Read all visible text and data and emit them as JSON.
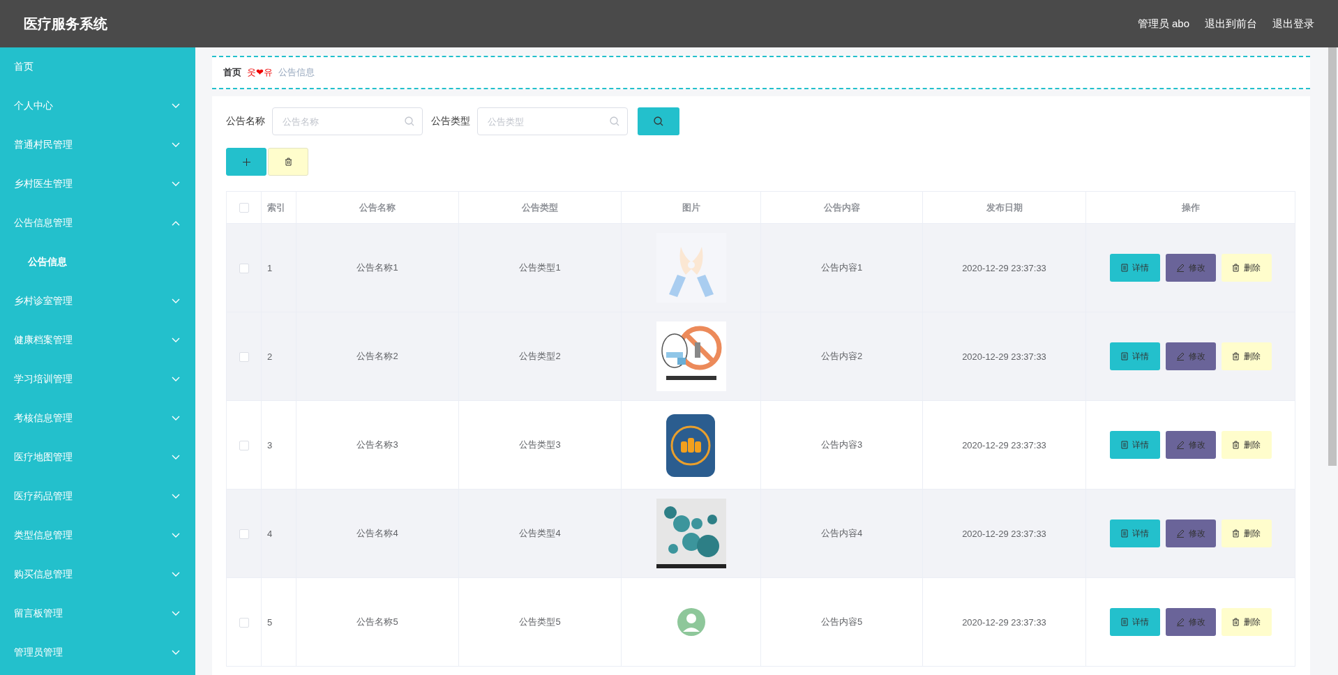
{
  "header": {
    "title": "医疗服务系统",
    "links": [
      "管理员 abo",
      "退出到前台",
      "退出登录"
    ]
  },
  "sidebar": {
    "items": [
      {
        "label": "首页",
        "kind": "link"
      },
      {
        "label": "个人中心",
        "kind": "menu",
        "expanded": false
      },
      {
        "label": "普通村民管理",
        "kind": "menu",
        "expanded": false
      },
      {
        "label": "乡村医生管理",
        "kind": "menu",
        "expanded": false
      },
      {
        "label": "公告信息管理",
        "kind": "menu",
        "expanded": true,
        "children": [
          {
            "label": "公告信息"
          }
        ]
      },
      {
        "label": "乡村诊室管理",
        "kind": "menu",
        "expanded": false
      },
      {
        "label": "健康档案管理",
        "kind": "menu",
        "expanded": false
      },
      {
        "label": "学习培训管理",
        "kind": "menu",
        "expanded": false
      },
      {
        "label": "考核信息管理",
        "kind": "menu",
        "expanded": false
      },
      {
        "label": "医疗地图管理",
        "kind": "menu",
        "expanded": false
      },
      {
        "label": "医疗药品管理",
        "kind": "menu",
        "expanded": false
      },
      {
        "label": "类型信息管理",
        "kind": "menu",
        "expanded": false
      },
      {
        "label": "购买信息管理",
        "kind": "menu",
        "expanded": false
      },
      {
        "label": "留言板管理",
        "kind": "menu",
        "expanded": false
      },
      {
        "label": "管理员管理",
        "kind": "menu",
        "expanded": false
      }
    ]
  },
  "breadcrumb": {
    "home": "首页",
    "separator": "웃❤유",
    "current": "公告信息"
  },
  "search": {
    "fields": [
      {
        "label": "公告名称",
        "placeholder": "公告名称"
      },
      {
        "label": "公告类型",
        "placeholder": "公告类型"
      }
    ]
  },
  "table": {
    "all_checked": false,
    "columns": [
      "索引",
      "公告名称",
      "公告类型",
      "图片",
      "公告内容",
      "发布日期",
      "操作"
    ],
    "rows": [
      {
        "checked": false,
        "highlighted": true,
        "index": "1",
        "name": "公告名称1",
        "type": "公告类型1",
        "content": "公告内容1",
        "date": "2020-12-29 23:37:33",
        "actions": [
          "详情",
          "修改",
          "删除"
        ]
      },
      {
        "checked": false,
        "highlighted": true,
        "index": "2",
        "name": "公告名称2",
        "type": "公告类型2",
        "content": "公告内容2",
        "date": "2020-12-29 23:37:33",
        "actions": [
          "详情",
          "修改",
          "删除"
        ]
      },
      {
        "checked": false,
        "highlighted": false,
        "index": "3",
        "name": "公告名称3",
        "type": "公告类型3",
        "content": "公告内容3",
        "date": "2020-12-29 23:37:33",
        "actions": [
          "详情",
          "修改",
          "删除"
        ]
      },
      {
        "checked": false,
        "highlighted": true,
        "index": "4",
        "name": "公告名称4",
        "type": "公告类型4",
        "content": "公告内容4",
        "date": "2020-12-29 23:37:33",
        "actions": [
          "详情",
          "修改",
          "删除"
        ]
      },
      {
        "checked": false,
        "highlighted": false,
        "index": "5",
        "name": "公告名称5",
        "type": "公告类型5",
        "content": "公告内容5",
        "date": "2020-12-29 23:37:33",
        "actions": [
          "详情",
          "修改",
          "删除"
        ]
      }
    ]
  }
}
